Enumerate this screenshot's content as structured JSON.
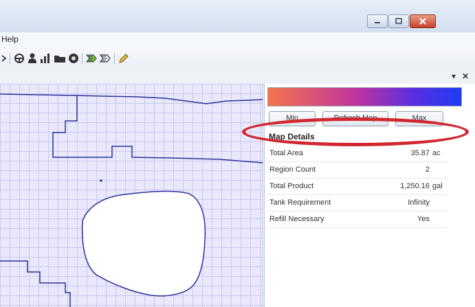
{
  "colors": {
    "titlebar": "#d3dfef",
    "map_bg": "#e9e9fb",
    "grid": "#c9c9ef",
    "path": "#2a2f9a",
    "highlight": "#d1272f"
  },
  "window_controls": {
    "minimize_icon": "minimize-icon",
    "maximize_icon": "maximize-icon",
    "close_icon": "close-icon"
  },
  "menubar": {
    "help_label": "Help"
  },
  "toolbar": {
    "icons": [
      "arrow-icon",
      "steering-wheel-icon",
      "person-icon",
      "bar-chart-icon",
      "folder-icon",
      "record-icon",
      "layers-green-icon",
      "layers-white-icon",
      "pencil-icon"
    ]
  },
  "panel_header": {
    "pin_symbol": "▾",
    "close_symbol": "✕"
  },
  "sidebar": {
    "buttons": {
      "min": "Min",
      "refresh": "Refresh Map",
      "max": "Max"
    },
    "details_title": "Map Details",
    "details": [
      {
        "label": "Total Area",
        "value": "35.87",
        "unit": "ac"
      },
      {
        "label": "Region Count",
        "value": "2",
        "unit": ""
      },
      {
        "label": "Total Product",
        "value": "1,250.16",
        "unit": "gal"
      },
      {
        "label": "Tank Requirement",
        "value": "Infinity",
        "unit": ""
      },
      {
        "label": "Refill Necessary",
        "value": "Yes",
        "unit": ""
      }
    ]
  }
}
